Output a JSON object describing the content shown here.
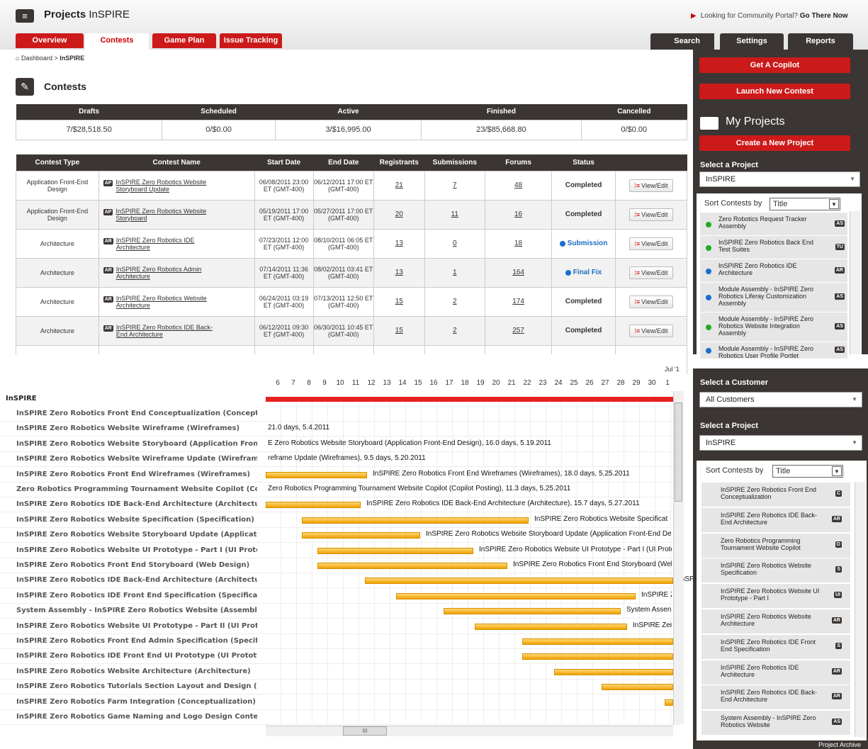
{
  "header": {
    "menu_icon": "list-icon",
    "app_name": "Projects",
    "app_project": "InSPIRE",
    "portal_text": "Looking for Community Portal?",
    "portal_link": "Go There Now"
  },
  "tabs": {
    "left": [
      "Overview",
      "Contests",
      "Game Plan",
      "Issue Tracking"
    ],
    "right": [
      "Search",
      "Settings",
      "Reports"
    ]
  },
  "breadcrumb": {
    "home": "Dashboard",
    "sep": ">",
    "current": "InSPIRE"
  },
  "contests_title": "Contests",
  "summary": {
    "headers": [
      "Drafts",
      "Scheduled",
      "Active",
      "Finished",
      "Cancelled"
    ],
    "values": [
      "7/$28,518.50",
      "0/$0.00",
      "3/$16,995.00",
      "23/$85,668.80",
      "0/$0.00"
    ]
  },
  "contest_table": {
    "headers": [
      "Contest Type",
      "Contest Name",
      "Start Date",
      "End Date",
      "Registrants",
      "Submissions",
      "Forums",
      "Status",
      ""
    ],
    "action_label": "View/Edit",
    "rows": [
      {
        "type": "Application Front-End Design",
        "badge": "AP",
        "name": "InSPIRE Zero Robotics Website Storyboard Update",
        "start": "06/08/2011 23:00 ET (GMT-400)",
        "end": "06/12/2011 17:00 ET (GMT-400)",
        "reg": "21",
        "sub": "7",
        "forums": "48",
        "status": "Completed"
      },
      {
        "type": "Application Front-End Design",
        "badge": "AP",
        "name": "InSPIRE Zero Robotics Website Storyboard",
        "start": "05/19/2011 17:00 ET (GMT-400)",
        "end": "05/27/2011 17:00 ET (GMT-400)",
        "reg": "20",
        "sub": "11",
        "forums": "16",
        "status": "Completed"
      },
      {
        "type": "Architecture",
        "badge": "AR",
        "name": "InSPIRE Zero Robotics IDE Architecture",
        "start": "07/23/2011 12:00 ET (GMT-400)",
        "end": "08/10/2011 06:05 ET (GMT-400)",
        "reg": "13",
        "sub": "0",
        "forums": "18",
        "status": "Submission"
      },
      {
        "type": "Architecture",
        "badge": "AR",
        "name": "InSPIRE Zero Robotics Admin Architecture",
        "start": "07/14/2011 11:36 ET (GMT-400)",
        "end": "08/02/2011 03:41 ET (GMT-400)",
        "reg": "13",
        "sub": "1",
        "forums": "164",
        "status": "Final Fix"
      },
      {
        "type": "Architecture",
        "badge": "AR",
        "name": "InSPIRE Zero Robotics Website Architecture",
        "start": "06/24/2011 03:19 ET (GMT-400)",
        "end": "07/13/2011 12:50 ET (GMT-400)",
        "reg": "15",
        "sub": "2",
        "forums": "174",
        "status": "Completed"
      },
      {
        "type": "Architecture",
        "badge": "AR",
        "name": "InSPIRE Zero Robotics IDE Back-End Architecture",
        "start": "06/12/2011 09:30 ET (GMT-400)",
        "end": "06/30/2011 10:45 ET (GMT-400)",
        "reg": "15",
        "sub": "2",
        "forums": "257",
        "status": "Completed"
      }
    ]
  },
  "sidebar_top": {
    "get_copilot": "Get A Copilot",
    "launch_contest": "Launch New Contest",
    "my_projects": "My Projects",
    "create_project": "Create a New Project",
    "select_project_label": "Select a Project",
    "selected_project": "InSPIRE",
    "sort_label": "Sort Contests by",
    "sort_value": "Title",
    "items": [
      {
        "dot": "#22aa22",
        "text": "Zero Robotics Request Tracker Assembly",
        "badge": "AS"
      },
      {
        "dot": "#22aa22",
        "text": "InSPIRE Zero Robotics Back End Test Suites",
        "badge": "TU"
      },
      {
        "dot": "#1a6fd0",
        "text": "InSPIRE Zero Robotics IDE Architecture",
        "badge": "AR"
      },
      {
        "dot": "#1a6fd0",
        "text": "Module Assembly - InSPIRE Zero Robotics Liferay Customization Assembly",
        "badge": "AS"
      },
      {
        "dot": "#22aa22",
        "text": "Module Assembly - InSPIRE Zero Robotics Website Integration Assembly",
        "badge": "AS"
      },
      {
        "dot": "#1a6fd0",
        "text": "Module Assembly - InSPIRE Zero Robotics User Profile Portlet",
        "badge": "AS"
      }
    ]
  },
  "gantt": {
    "month_label": "Jul '1",
    "days": [
      "6",
      "7",
      "8",
      "9",
      "10",
      "11",
      "12",
      "13",
      "14",
      "15",
      "16",
      "17",
      "18",
      "19",
      "20",
      "21",
      "22",
      "23",
      "24",
      "25",
      "26",
      "27",
      "28",
      "29",
      "30",
      "1"
    ],
    "root": "InSPIRE",
    "rows": [
      {
        "name": "InSPIRE Zero Robotics Front End Conceptualization (Conceptualizat...",
        "label": ""
      },
      {
        "name": "InSPIRE Zero Robotics Website Wireframe (Wireframes)",
        "label": "21.0 days, 5.4.2011"
      },
      {
        "name": "InSPIRE Zero Robotics Website Storyboard (Application Front-End ...",
        "label": "E Zero Robotics Website Storyboard (Application Front-End Design), 16.0 days, 5.19.2011"
      },
      {
        "name": "InSPIRE Zero Robotics Website Wireframe Update (Wireframes)",
        "label": "reframe Update (Wireframes), 9.5 days, 5.20.2011"
      },
      {
        "name": "InSPIRE Zero Robotics Front End Wireframes (Wireframes)",
        "label": "InSPIRE Zero Robotics Front End Wireframes (Wireframes), 18.0 days, 5.25.2011"
      },
      {
        "name": "Zero Robotics Programming Tournament Website Copilot (Copilot ...",
        "label": "Zero Robotics Programming Tournament Website Copilot (Copilot Posting), 11.3 days, 5.25.2011"
      },
      {
        "name": "InSPIRE Zero Robotics IDE Back-End Architecture (Architecture)",
        "label": "InSPIRE Zero Robotics IDE Back-End Architecture (Architecture), 15.7 days, 5.27.2011"
      },
      {
        "name": "InSPIRE Zero Robotics Website Specification (Specification)",
        "label": "InSPIRE Zero Robotics Website Specificat"
      },
      {
        "name": "InSPIRE Zero Robotics Website Storyboard Update (Application Fro...",
        "label": "InSPIRE Zero Robotics Website Storyboard Update (Application Front-End Des"
      },
      {
        "name": "InSPIRE Zero Robotics Website UI Prototype - Part I (UI Prototype C...",
        "label": "InSPIRE Zero Robotics Website UI Prototype - Part I (UI Prototy"
      },
      {
        "name": "InSPIRE Zero Robotics Front End Storyboard (Web Design)",
        "label": "InSPIRE Zero Robotics Front End Storyboard (Web"
      },
      {
        "name": "InSPIRE Zero Robotics IDE Back-End Architecture (Architecture)",
        "label": "InSPII"
      },
      {
        "name": "InSPIRE Zero Robotics IDE Front End Specification (Specification)",
        "label": "InSPIRE Zero Ro"
      },
      {
        "name": "System Assembly - InSPIRE Zero Robotics Website (Assembly Com...",
        "label": "System Assen"
      },
      {
        "name": "InSPIRE Zero Robotics Website UI Prototype - Part II (UI Prototype ...",
        "label": "InSPIRE Zerc"
      },
      {
        "name": "InSPIRE Zero Robotics Front End Admin Specification (Specification)",
        "label": ""
      },
      {
        "name": "InSPIRE Zero Robotics IDE Front End UI Prototype (UI Prototype Com...",
        "label": ""
      },
      {
        "name": "InSPIRE Zero Robotics Website Architecture (Architecture)",
        "label": ""
      },
      {
        "name": "InSPIRE Zero Robotics Tutorials Section Layout and Design (Web D...",
        "label": ""
      },
      {
        "name": "InSPIRE Zero Robotics Farm Integration (Conceptualization)",
        "label": ""
      },
      {
        "name": "InSPIRE Zero Robotics Game Naming and Logo Design Contest (Lo...",
        "label": ""
      }
    ],
    "scroll_thumb": "III"
  },
  "sidebar_bottom": {
    "customer_label": "Select a Customer",
    "customer_value": "All Customers",
    "project_label": "Select a Project",
    "project_value": "InSPIRE",
    "sort_label": "Sort Contests by",
    "sort_value": "Title",
    "items": [
      {
        "text": "InSPIRE Zero Robotics Front End Conceptualization",
        "badge": "C"
      },
      {
        "text": "InSPIRE Zero Robotics IDE Back-End Architecture",
        "badge": "AR"
      },
      {
        "text": "Zero Robotics Programming Tournament Website Copilot",
        "badge": "O"
      },
      {
        "text": "InSPIRE Zero Robotics Website Specification",
        "badge": "S"
      },
      {
        "text": "InSPIRE Zero Robotics Website UI Prototype - Part I",
        "badge": "UI"
      },
      {
        "text": "InSPIRE Zero Robotics Website Architecture",
        "badge": "AR"
      },
      {
        "text": "InSPIRE Zero Robotics IDE Front End Specification",
        "badge": "S"
      },
      {
        "text": "InSPIRE Zero Robotics IDE Architecture",
        "badge": "AR"
      },
      {
        "text": "InSPIRE Zero Robotics IDE Back-End Architecture",
        "badge": "AR"
      },
      {
        "text": "System Assembly - InSPIRE Zero Robotics Website",
        "badge": "AS"
      }
    ],
    "archive": "Project Archive"
  }
}
